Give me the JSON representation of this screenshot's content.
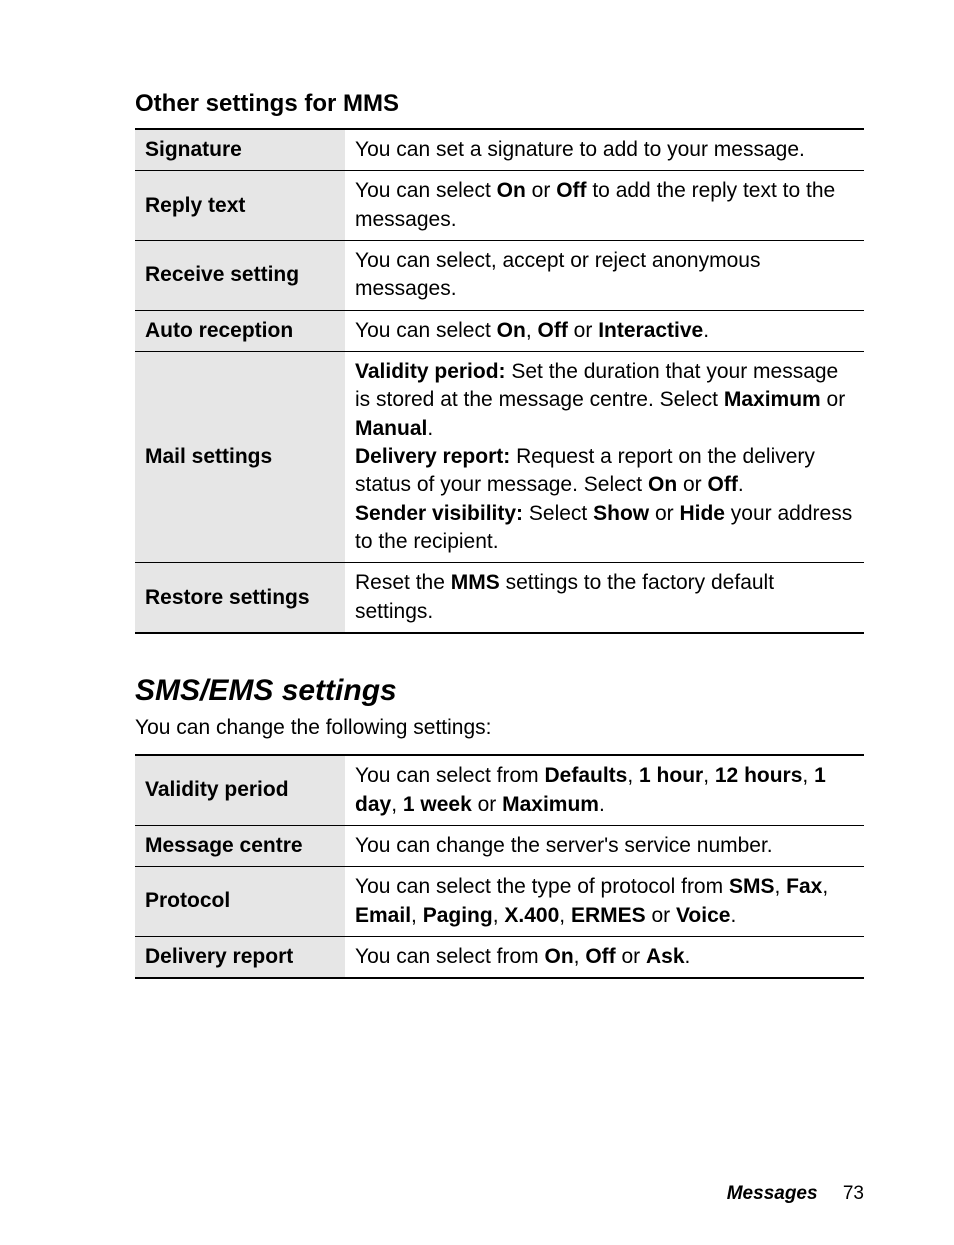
{
  "mms": {
    "heading": "Other settings for MMS",
    "rows": {
      "signature": {
        "label": "Signature",
        "desc": "You can set a signature to add to your message."
      },
      "reply_text": {
        "label": "Reply text",
        "desc_pre": "You can select ",
        "on": "On",
        "or1": " or ",
        "off": "Off",
        "desc_post": " to add the reply text to the messages."
      },
      "receive_setting": {
        "label": "Receive setting",
        "desc": "You can select, accept or reject anonymous messages."
      },
      "auto_reception": {
        "label": "Auto reception",
        "desc_pre": "You can select ",
        "on": "On",
        "c1": ", ",
        "off": "Off",
        "or": " or ",
        "interactive": "Interactive",
        "period": "."
      },
      "mail_settings": {
        "label": "Mail settings",
        "vp_label": "Validity period:",
        "vp_text1": " Set the duration that your message is stored at the message centre. Select ",
        "vp_max": "Maximum",
        "vp_or": " or ",
        "vp_manual": "Manual",
        "vp_period": ".",
        "dr_label": "Delivery report:",
        "dr_text1": " Request a report on the delivery status of your message. Select ",
        "dr_on": "On",
        "dr_or": " or ",
        "dr_off": "Off",
        "dr_period": ".",
        "sv_label": "Sender visibility:",
        "sv_text1": " Select ",
        "sv_show": "Show",
        "sv_or": " or ",
        "sv_hide": "Hide",
        "sv_text2": " your address to the recipient."
      },
      "restore_settings": {
        "label": "Restore settings",
        "desc_pre": "Reset the ",
        "mms": "MMS",
        "desc_post": " settings to the factory default settings."
      }
    }
  },
  "sms": {
    "heading": "SMS/EMS settings",
    "intro": "You can change the following settings:",
    "rows": {
      "validity_period": {
        "label": "Validity period",
        "pre": "You can select from ",
        "defaults": "Defaults",
        "c1": ", ",
        "h1": "1 hour",
        "c2": ", ",
        "h12": "12 hours",
        "c3": ", ",
        "d1": "1 day",
        "c4": ", ",
        "w1": "1 week",
        "or": " or ",
        "max": "Maximum",
        "period": "."
      },
      "message_centre": {
        "label": "Message centre",
        "desc": "You can change the server's service number."
      },
      "protocol": {
        "label": "Protocol",
        "pre": "You can select the type of protocol from ",
        "sms": "SMS",
        "c1": ", ",
        "fax": "Fax",
        "c2": ", ",
        "email": "Email",
        "c3": ", ",
        "paging": "Paging",
        "c4": ", ",
        "x400": "X.400",
        "c5": ", ",
        "ermes": "ERMES",
        "or": " or ",
        "voice": "Voice",
        "period": "."
      },
      "delivery_report": {
        "label": "Delivery report",
        "pre": "You can select from ",
        "on": "On",
        "c1": ", ",
        "off": "Off",
        "or": " or ",
        "ask": "Ask",
        "period": "."
      }
    }
  },
  "footer": {
    "chapter": "Messages",
    "page": "73"
  }
}
